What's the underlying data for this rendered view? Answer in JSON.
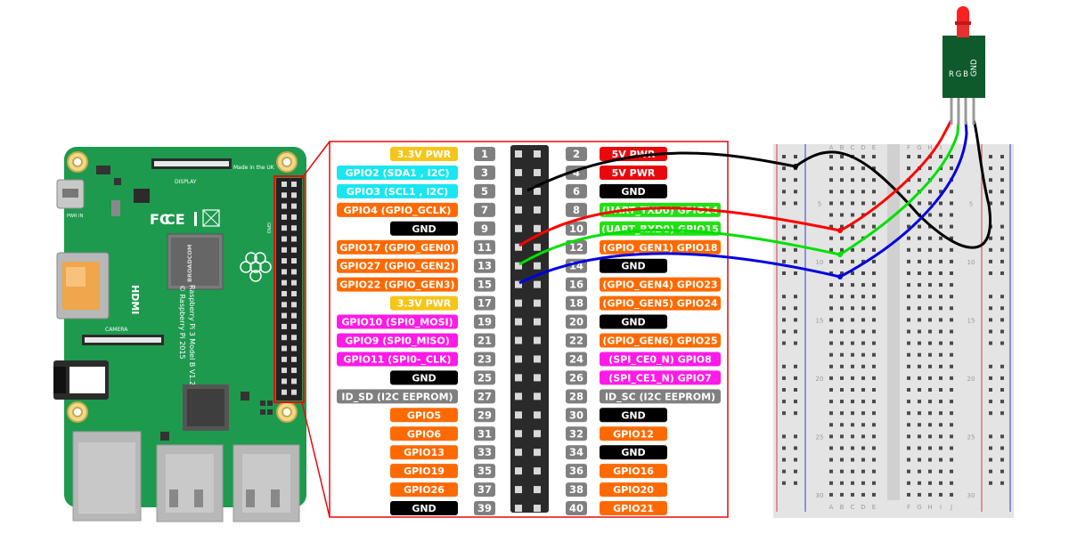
{
  "board": {
    "model_text": "Raspberry Pi 3 Model B V1.2",
    "copyright_text": "© Raspberry Pi 2015",
    "made_in": "Made in the UK",
    "display_label": "DISPLAY",
    "camera_label": "CAMERA",
    "power_label": "PWR IN",
    "hdmi_label": "HDMI",
    "gpio_label": "GPIO",
    "chip_brand": "BROADCOM"
  },
  "colors": {
    "power33": "#f5c518",
    "power5": "#e8090c",
    "ground": "#000000",
    "i2c": "#19e6f0",
    "gpio": "#ff6a00",
    "uart": "#22e011",
    "spi": "#ff1ae8",
    "eeprom": "#808080",
    "pinnum": "#808080",
    "board": "#1d9a4e",
    "wire_red": "#ff0000",
    "wire_green": "#00e000",
    "wire_blue": "#0000e0",
    "wire_black": "#000000"
  },
  "pins": [
    {
      "num": "1",
      "label": "3.3V PWR",
      "type": "power33"
    },
    {
      "num": "2",
      "label": "5V PWR",
      "type": "power5"
    },
    {
      "num": "3",
      "label": "GPIO2 (SDA1 , I2C)",
      "type": "i2c"
    },
    {
      "num": "4",
      "label": "5V PWR",
      "type": "power5"
    },
    {
      "num": "5",
      "label": "GPIO3 (SCL1 , I2C)",
      "type": "i2c"
    },
    {
      "num": "6",
      "label": "GND",
      "type": "ground"
    },
    {
      "num": "7",
      "label": "GPIO4 (GPIO_GCLK)",
      "type": "gpio"
    },
    {
      "num": "8",
      "label": "(UART_TXD0) GPIO14",
      "type": "uart"
    },
    {
      "num": "9",
      "label": "GND",
      "type": "ground"
    },
    {
      "num": "10",
      "label": "(UART_RXD0) GPIO15",
      "type": "uart"
    },
    {
      "num": "11",
      "label": "GPIO17 (GPIO_GEN0)",
      "type": "gpio"
    },
    {
      "num": "12",
      "label": "(GPIO_GEN1) GPIO18",
      "type": "gpio"
    },
    {
      "num": "13",
      "label": "GPIO27 (GPIO_GEN2)",
      "type": "gpio"
    },
    {
      "num": "14",
      "label": "GND",
      "type": "ground"
    },
    {
      "num": "15",
      "label": "GPIO22 (GPIO_GEN3)",
      "type": "gpio"
    },
    {
      "num": "16",
      "label": "(GPIO_GEN4) GPIO23",
      "type": "gpio"
    },
    {
      "num": "17",
      "label": "3.3V PWR",
      "type": "power33"
    },
    {
      "num": "18",
      "label": "(GPIO_GEN5) GPIO24",
      "type": "gpio"
    },
    {
      "num": "19",
      "label": "GPIO10 (SPI0_MOSI)",
      "type": "spi"
    },
    {
      "num": "20",
      "label": "GND",
      "type": "ground"
    },
    {
      "num": "21",
      "label": "GPIO9 (SPI0_MISO)",
      "type": "spi"
    },
    {
      "num": "22",
      "label": "(GPIO_GEN6) GPIO25",
      "type": "gpio"
    },
    {
      "num": "23",
      "label": "GPIO11 (SPI0-_CLK)",
      "type": "spi"
    },
    {
      "num": "24",
      "label": "(SPI_CE0_N) GPIO8",
      "type": "spi"
    },
    {
      "num": "25",
      "label": "GND",
      "type": "ground"
    },
    {
      "num": "26",
      "label": "(SPI_CE1_N) GPIO7",
      "type": "spi"
    },
    {
      "num": "27",
      "label": "ID_SD (I2C EEPROM)",
      "type": "eeprom"
    },
    {
      "num": "28",
      "label": "ID_SC (I2C EEPROM)",
      "type": "eeprom"
    },
    {
      "num": "29",
      "label": "GPIO5",
      "type": "gpio"
    },
    {
      "num": "30",
      "label": "GND",
      "type": "ground"
    },
    {
      "num": "31",
      "label": "GPIO6",
      "type": "gpio"
    },
    {
      "num": "32",
      "label": "GPIO12",
      "type": "gpio"
    },
    {
      "num": "33",
      "label": "GPIO13",
      "type": "gpio"
    },
    {
      "num": "34",
      "label": "GND",
      "type": "ground"
    },
    {
      "num": "35",
      "label": "GPIO19",
      "type": "gpio"
    },
    {
      "num": "36",
      "label": "GPIO16",
      "type": "gpio"
    },
    {
      "num": "37",
      "label": "GPIO26",
      "type": "gpio"
    },
    {
      "num": "38",
      "label": "GPIO20",
      "type": "gpio"
    },
    {
      "num": "39",
      "label": "GND",
      "type": "ground"
    },
    {
      "num": "40",
      "label": "GPIO21",
      "type": "gpio"
    }
  ],
  "led_module": {
    "pin_labels": [
      "R",
      "G",
      "B",
      "GND"
    ]
  },
  "breadboard": {
    "col_letters_left": [
      "A",
      "B",
      "C",
      "D",
      "E"
    ],
    "col_letters_right": [
      "F",
      "G",
      "H",
      "I",
      "J"
    ],
    "row_numbers": [
      "5",
      "10",
      "15",
      "20",
      "25",
      "30"
    ]
  },
  "wiring": [
    {
      "from_pin": "11",
      "to": "R",
      "color": "wire_red"
    },
    {
      "from_pin": "13",
      "to": "G",
      "color": "wire_green"
    },
    {
      "from_pin": "15",
      "to": "B",
      "color": "wire_blue"
    },
    {
      "from_pin": "6",
      "to": "GND",
      "color": "wire_black"
    }
  ]
}
